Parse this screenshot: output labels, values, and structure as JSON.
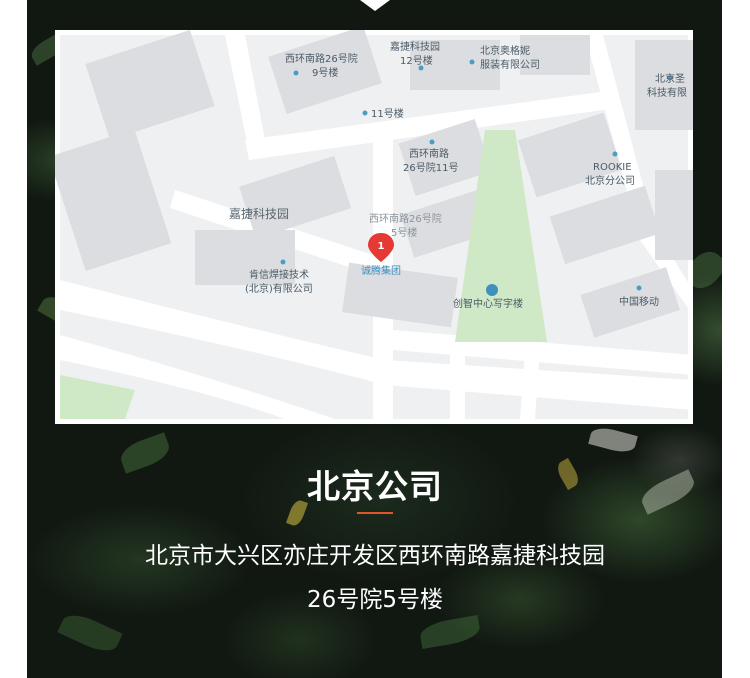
{
  "office": {
    "title": "北京公司",
    "address_line1": "北京市大兴区亦庄开发区西环南路嘉捷科技园",
    "address_line2": "26号院5号楼"
  },
  "colors": {
    "accent_divider": "#e0552c",
    "marker": "#e53935",
    "map_background": "#eef0f2",
    "map_building": "#dcdde0",
    "map_green": "#cfe8c6",
    "map_label": "#4a5a66"
  },
  "map": {
    "marker_number": "1",
    "labels": {
      "xihuan26_9": "西环南路26号院",
      "xihuan26_9_sub": "9号楼",
      "jiajie_tech_12": "嘉捷科技园",
      "jiajie_tech_12_sub": "12号楼",
      "ogani_1": "北京奥格妮",
      "ogani_2": "服装有限公司",
      "bldg_11": "11号楼",
      "xihuan_11_1": "西环南路",
      "xihuan_11_2": "26号院11号",
      "rookie_1": "ROOKIE",
      "rookie_2": "北京分公司",
      "right_edge_1": "北京圣",
      "right_edge_2": "科技有限",
      "jiajie_park": "嘉捷科技园",
      "xihuan26_5": "西环南路26号院",
      "xihuan26_5_sub": "5号楼",
      "chengteng": "诚腾集团",
      "kenxin_1": "肯信焊接技术",
      "kenxin_2": "(北京)有限公司",
      "chuangzhi": "创智中心写字楼",
      "china_mobile": "中国移动"
    }
  }
}
